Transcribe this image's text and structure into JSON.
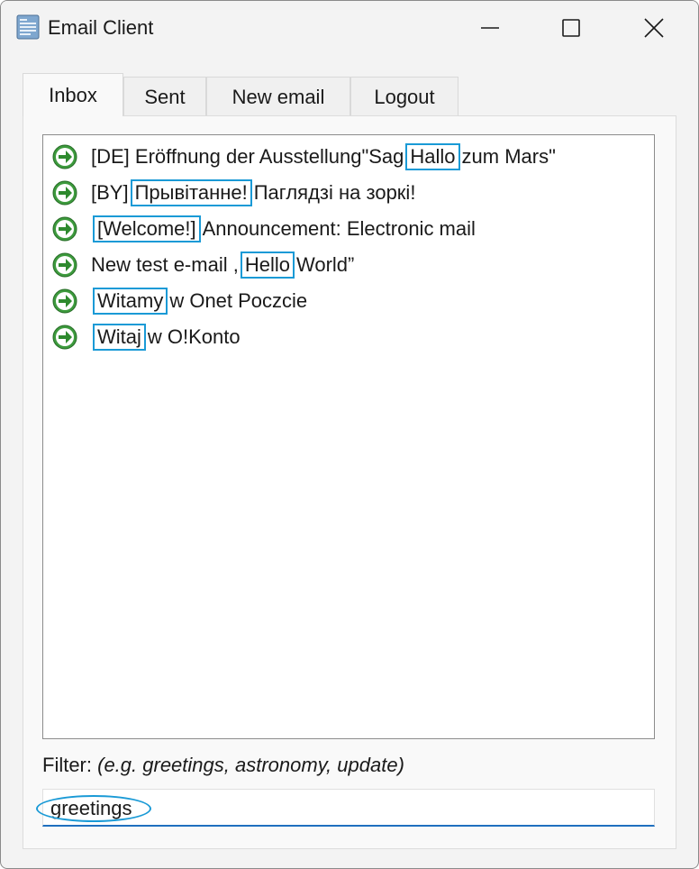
{
  "window": {
    "title": "Email Client",
    "icon": "document-icon"
  },
  "tabs": [
    {
      "label": "Inbox",
      "active": true
    },
    {
      "label": "Sent",
      "active": false
    },
    {
      "label": "New email",
      "active": false
    },
    {
      "label": "Logout",
      "active": false
    }
  ],
  "inbox": {
    "items": [
      {
        "before": "[DE] Eröffnung der Ausstellung\"Sag",
        "keyword": "Hallo",
        "after": "zum Mars\""
      },
      {
        "before": "[BY]",
        "keyword": "Прывітанне!",
        "after": "Паглядзі на зоркі!"
      },
      {
        "before": "",
        "keyword": "[Welcome!]",
        "after": "Announcement: Electronic mail"
      },
      {
        "before": "New test e-mail ,",
        "keyword": "Hello",
        "after": "World”"
      },
      {
        "before": "",
        "keyword": "Witamy",
        "after": "w Onet Poczcie"
      },
      {
        "before": "",
        "keyword": "Witaj",
        "after": "w O!Konto"
      }
    ]
  },
  "filter": {
    "label": "Filter:",
    "hint": "(e.g. greetings, astronomy, update)",
    "value": "greetings"
  },
  "colors": {
    "highlight": "#1a9ad6",
    "arrow_icon": "#3d9a3d",
    "input_underline": "#1f6fbf"
  }
}
